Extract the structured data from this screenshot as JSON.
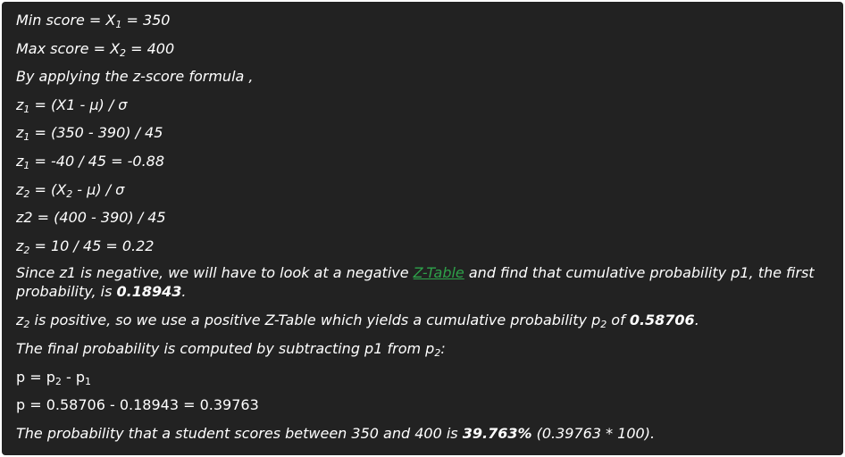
{
  "lines": {
    "min_label": "Min score = X",
    "min_sub": "1",
    "min_val": " = 350",
    "max_label": "Max score = X",
    "max_sub": "2",
    "max_val": " = 400",
    "apply": "By applying the z-score formula ,",
    "z1_var": "z",
    "z1_sub": "1",
    "z1_formula": " = (X1 - µ) / σ",
    "z1_calc_var": "z",
    "z1_calc_sub": "1",
    "z1_calc": " = (350 - 390) / 45",
    "z1_res_var": "z",
    "z1_res_sub": "1",
    "z1_res": " = -40 / 45 = -0.88",
    "z2_var": "z",
    "z2_sub": "2",
    "z2_mid": " = (X",
    "z2_sub2": "2",
    "z2_end": " - µ) / σ",
    "z2_calc": "z2 = (400 - 390) / 45",
    "z2_res_var": "z",
    "z2_res_sub": "2",
    "z2_res": " = 10 / 45 = 0.22",
    "since_a": "Since z1 is negative, we will have to look at a negative ",
    "since_link": "Z-Table",
    "since_b": " and find that cumulative probability p1, the first probability, is ",
    "since_val": "0.18943",
    "since_end": ".",
    "pos_var": "z",
    "pos_sub": "2",
    "pos_a": " is positive, so we use a positive Z-Table which yields a cumulative probability p",
    "pos_sub2": "2",
    "pos_b": " of ",
    "pos_val": "0.58706",
    "pos_end": ".",
    "final_a": "The final probability is computed by subtracting p1 from p",
    "final_sub": "2",
    "final_end": ":",
    "p_a": "p = p",
    "p_sub1": "2",
    "p_b": " - p",
    "p_sub2": "1",
    "p_calc": "p = 0.58706 - 0.18943 = 0.39763",
    "prob_a": "The probability that a student scores between 350 and 400 is ",
    "prob_val": "39.763%",
    "prob_end": " (0.39763 * 100)."
  }
}
